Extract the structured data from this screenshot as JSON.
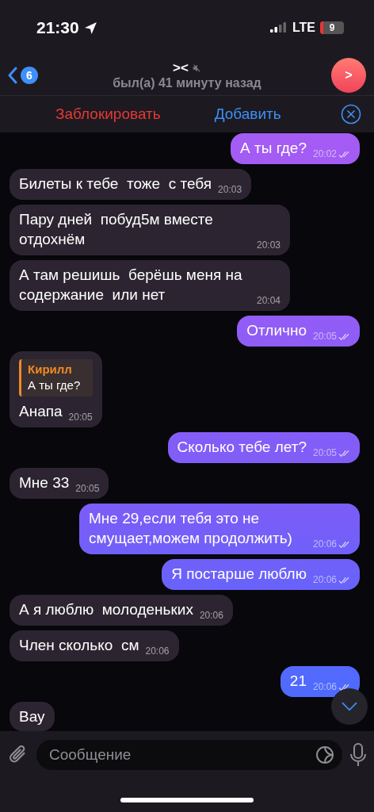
{
  "status_bar": {
    "time": "21:30",
    "network": "LTE",
    "battery": "9"
  },
  "header": {
    "back_count": "6",
    "title": "><",
    "muted": true,
    "subtitle": "был(а) 41 минуту назад",
    "avatar": ">"
  },
  "action_bar": {
    "block": "Заблокировать",
    "add": "Добавить"
  },
  "messages": [
    {
      "kind": "text",
      "out": true,
      "text": "А ты где?",
      "time": "20:02",
      "read": true
    },
    {
      "kind": "text",
      "out": false,
      "text": "Билеты к тебе  тоже  с тебя",
      "time": "20:03"
    },
    {
      "kind": "text",
      "out": false,
      "text": "Пару дней  побуд5м вместе отдохнём",
      "time": "20:03"
    },
    {
      "kind": "text",
      "out": false,
      "text": "А там решишь  берёшь меня на содержание  или нет",
      "time": "20:04"
    },
    {
      "kind": "text",
      "out": true,
      "text": "Отлично",
      "time": "20:05",
      "read": true
    },
    {
      "kind": "reply",
      "out": false,
      "reply_author": "Кирилл",
      "reply_text": "А ты где?",
      "text": "Анапа",
      "time": "20:05"
    },
    {
      "kind": "text",
      "out": true,
      "text": "Сколько тебе лет?",
      "time": "20:05",
      "read": true
    },
    {
      "kind": "text",
      "out": false,
      "text": "Мне 33",
      "time": "20:05"
    },
    {
      "kind": "text",
      "out": true,
      "text": "Мне 29,если тебя это не смущает,можем продолжить)",
      "time": "20:06",
      "read": true
    },
    {
      "kind": "text",
      "out": true,
      "text": "Я постарше люблю",
      "time": "20:06",
      "read": true
    },
    {
      "kind": "text",
      "out": false,
      "text": "А я люблю  молоденьких",
      "time": "20:06"
    },
    {
      "kind": "text",
      "out": false,
      "text": "Член сколько  см",
      "time": "20:06"
    },
    {
      "kind": "text",
      "out": true,
      "text": "21",
      "time": "20:06",
      "read": true
    },
    {
      "kind": "text",
      "out": false,
      "text": "Вау"
    }
  ],
  "composer": {
    "placeholder": "Сообщение"
  }
}
